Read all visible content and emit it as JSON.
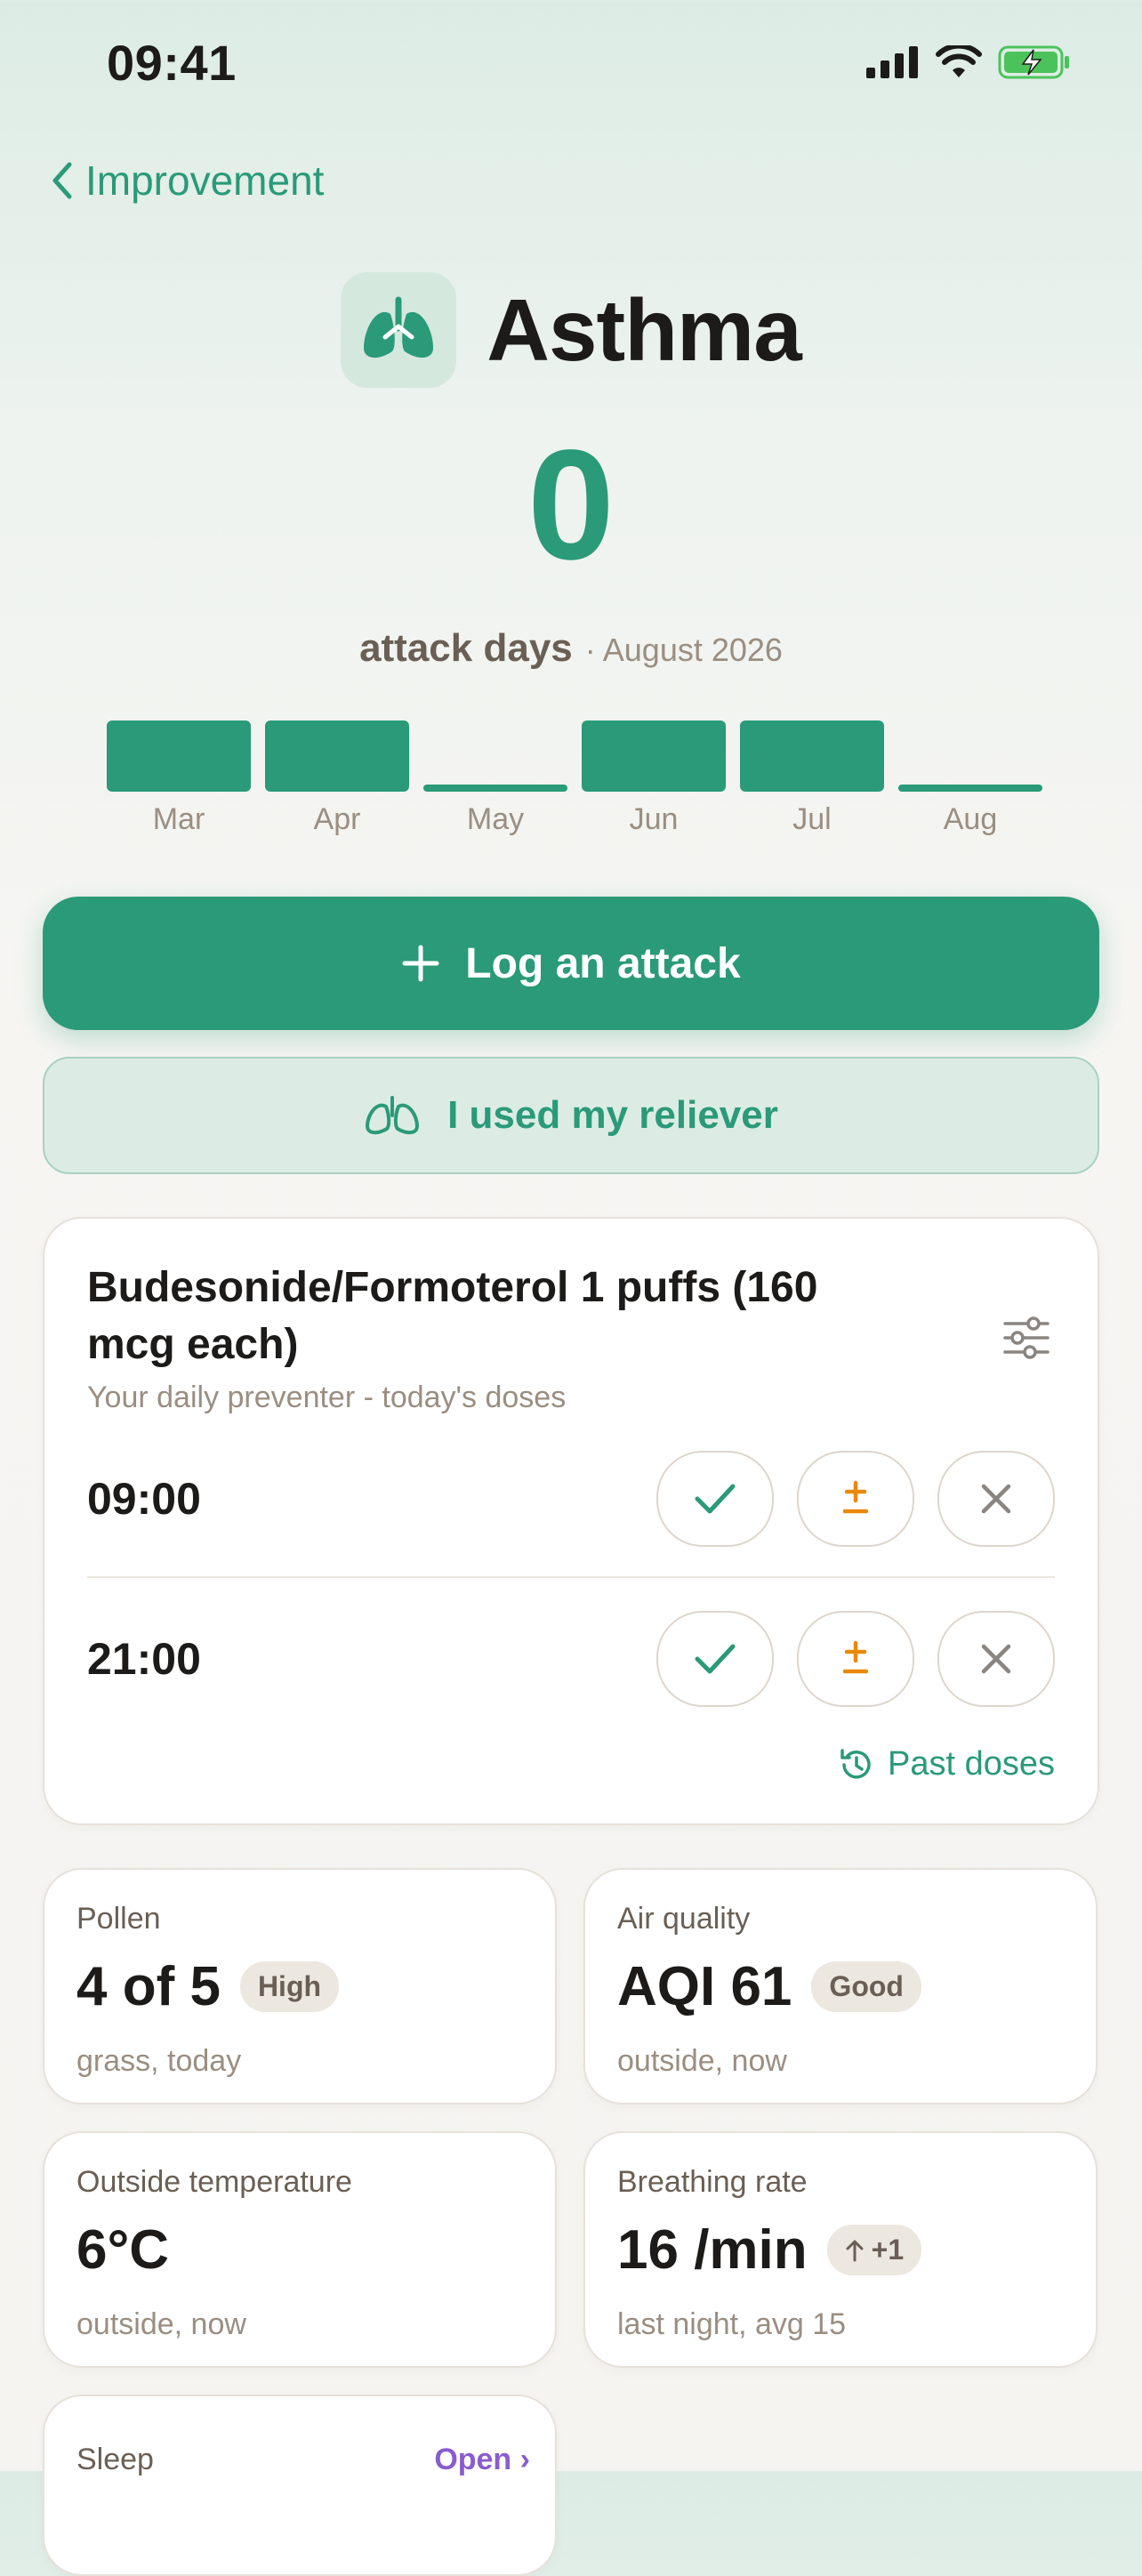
{
  "status_bar": {
    "time": "09:41"
  },
  "nav": {
    "back_label": "Improvement"
  },
  "header": {
    "title": "Asthma",
    "count": "0",
    "count_label": "attack days",
    "period": "· August 2026"
  },
  "months": [
    {
      "label": "Mar",
      "level": 1
    },
    {
      "label": "Apr",
      "level": 1
    },
    {
      "label": "May",
      "level": 0
    },
    {
      "label": "Jun",
      "level": 1
    },
    {
      "label": "Jul",
      "level": 1
    },
    {
      "label": "Aug",
      "level": 0
    }
  ],
  "actions": {
    "log_attack": "Log an attack",
    "reliever": "I used my reliever"
  },
  "medication": {
    "title": "Budesonide/Formoterol 1 puffs (160 mcg each)",
    "subtitle": "Your daily preventer - today's doses",
    "doses": [
      {
        "time": "09:00"
      },
      {
        "time": "21:00"
      }
    ],
    "past_doses_label": "Past doses"
  },
  "metrics": [
    {
      "label": "Pollen",
      "value": "4 of 5",
      "badge": "High",
      "note": "grass, today"
    },
    {
      "label": "Air quality",
      "value": "AQI 61",
      "badge": "Good",
      "note": "outside, now"
    },
    {
      "label": "Outside temperature",
      "value": "6°C",
      "badge": "",
      "note": "outside, now"
    },
    {
      "label": "Breathing rate",
      "value": "16 /min",
      "badge": "+1",
      "note": "last night, avg 15"
    }
  ],
  "sleep": {
    "label": "Sleep",
    "open_label": "Open"
  },
  "colors": {
    "accent": "#2a9a78",
    "warning": "#e8890c",
    "muted": "#8a8580",
    "link_purple": "#8a5ccf"
  }
}
